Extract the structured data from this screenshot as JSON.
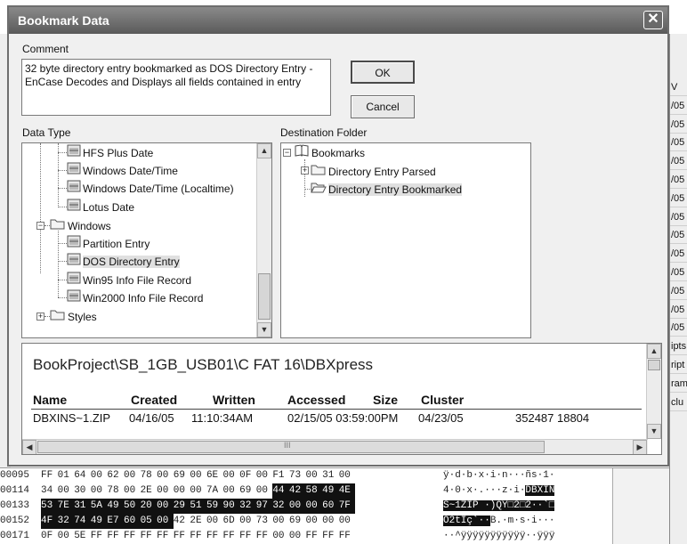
{
  "dialog": {
    "title": "Bookmark Data",
    "close_glyph": "✕",
    "comment_label": "Comment",
    "comment_text": "32 byte directory entry bookmarked as DOS Directory Entry - EnCase Decodes and Displays all fields contained in entry",
    "ok_label": "OK",
    "cancel_label": "Cancel",
    "data_type_label": "Data Type",
    "destination_label": "Destination Folder"
  },
  "data_type_tree": [
    {
      "label": "HFS Plus Date"
    },
    {
      "label": "Windows Date/Time"
    },
    {
      "label": "Windows Date/Time (Localtime)"
    },
    {
      "label": "Lotus Date"
    },
    {
      "label": "Windows"
    },
    {
      "label": "Partition Entry"
    },
    {
      "label": "DOS Directory Entry"
    },
    {
      "label": "Win95 Info File Record"
    },
    {
      "label": "Win2000 Info File Record"
    },
    {
      "label": "Styles"
    }
  ],
  "destination_tree": [
    {
      "label": "Bookmarks"
    },
    {
      "label": "Directory Entry Parsed"
    },
    {
      "label": "Directory Entry Bookmarked"
    }
  ],
  "details": {
    "path": "BookProject\\SB_1GB_USB01\\C FAT 16\\DBXpress",
    "headers": [
      "Name",
      "Created",
      "Written",
      "Accessed",
      "Size",
      "Cluster"
    ],
    "row": {
      "name": "DBXINS~1.ZIP",
      "created": "04/16/05",
      "written": "11:10:34AM",
      "accessed": "02/15/05 03:59:00PM",
      "size": "04/23/05",
      "cluster": "352487 18804"
    },
    "scroll_grip": "III"
  },
  "background_right_cells": [
    "V",
    "/05",
    "/05",
    "/05",
    "/05",
    "/05",
    "/05",
    "/05",
    "/05",
    "/05",
    "/05",
    "/05",
    "/05",
    "/05",
    "ipts",
    "ript",
    "ram",
    "clu"
  ],
  "hex_rows": [
    {
      "offset": "00095",
      "bytes": [
        "FF",
        "01",
        "64",
        "00",
        "62",
        "00",
        "78",
        "00",
        "69",
        "00",
        "6E",
        "00",
        "0F",
        "00",
        "F1",
        "73",
        "00",
        "31",
        "00"
      ],
      "sel": [],
      "ascii": "ÿ·d·b·x·i·n···ñs·1·",
      "ascii_sel": ""
    },
    {
      "offset": "00114",
      "bytes": [
        "34",
        "00",
        "30",
        "00",
        "78",
        "00",
        "2E",
        "00",
        "00",
        "00",
        "7A",
        "00",
        "69",
        "00",
        "44",
        "42",
        "58",
        "49",
        "4E"
      ],
      "sel": [
        14,
        15,
        16,
        17,
        18
      ],
      "ascii": "4·0·x·.···z·i·",
      "ascii_sel": "DBXIN"
    },
    {
      "offset": "00133",
      "bytes": [
        "53",
        "7E",
        "31",
        "5A",
        "49",
        "50",
        "20",
        "00",
        "29",
        "51",
        "59",
        "90",
        "32",
        "97",
        "32",
        "00",
        "00",
        "60",
        "7F"
      ],
      "sel": [
        0,
        1,
        2,
        3,
        4,
        5,
        6,
        7,
        8,
        9,
        10,
        11,
        12,
        13,
        14,
        15,
        16,
        17,
        18
      ],
      "ascii": "",
      "ascii_sel": "S~1ZIP ·)QY□2□2··`□"
    },
    {
      "offset": "00152",
      "bytes": [
        "4F",
        "32",
        "74",
        "49",
        "E7",
        "60",
        "05",
        "00",
        "42",
        "2E",
        "00",
        "6D",
        "00",
        "73",
        "00",
        "69",
        "00",
        "00",
        "00"
      ],
      "sel": [
        0,
        1,
        2,
        3,
        4,
        5,
        6,
        7
      ],
      "ascii": "B.·m·s·i···",
      "ascii_sel": "O2tIç`··"
    },
    {
      "offset": "00171",
      "bytes": [
        "0F",
        "00",
        "5E",
        "FF",
        "FF",
        "FF",
        "FF",
        "FF",
        "FF",
        "FF",
        "FF",
        "FF",
        "FF",
        "FF",
        "00",
        "00",
        "FF",
        "FF",
        "FF"
      ],
      "sel": [],
      "ascii": "··^ÿÿÿÿÿÿÿÿÿÿÿ··ÿÿÿ",
      "ascii_sel": ""
    }
  ]
}
